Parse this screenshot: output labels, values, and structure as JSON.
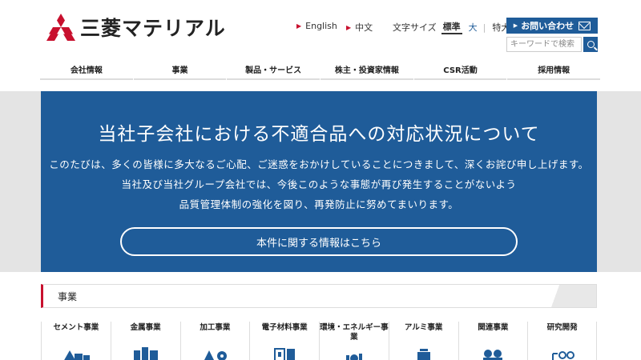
{
  "header": {
    "logo_text": "三菱マテリアル",
    "lang_english": "English",
    "lang_chinese": "中文",
    "fontsize_label": "文字サイズ",
    "fontsize_options": [
      "標準",
      "大",
      "特大"
    ],
    "contact_label": "お問い合わせ",
    "search_placeholder": "キーワードで検索"
  },
  "nav": [
    "会社情報",
    "事業",
    "製品・サービス",
    "株主・投資家情報",
    "CSR活動",
    "採用情報"
  ],
  "hero": {
    "title": "当社子会社における不適合品への対応状況について",
    "line1": "このたびは、多くの皆様に多大なるご心配、ご迷惑をおかけしていることにつきまして、深くお詫び申し上げます。",
    "line2": "当社及び当社グループ会社では、今後このような事態が再び発生することがないよう",
    "line3": "品質管理体制の強化を図り、再発防止に努めてまいります。",
    "button": "本件に関する情報はこちら"
  },
  "section": {
    "title": "事業"
  },
  "business": [
    "セメント事業",
    "金属事業",
    "加工事業",
    "電子材料事業",
    "環境・エネルギー事業",
    "アルミ事業",
    "関連事業",
    "研究開発"
  ],
  "colors": {
    "brand_blue": "#1f5c99",
    "brand_red": "#c8102e"
  }
}
